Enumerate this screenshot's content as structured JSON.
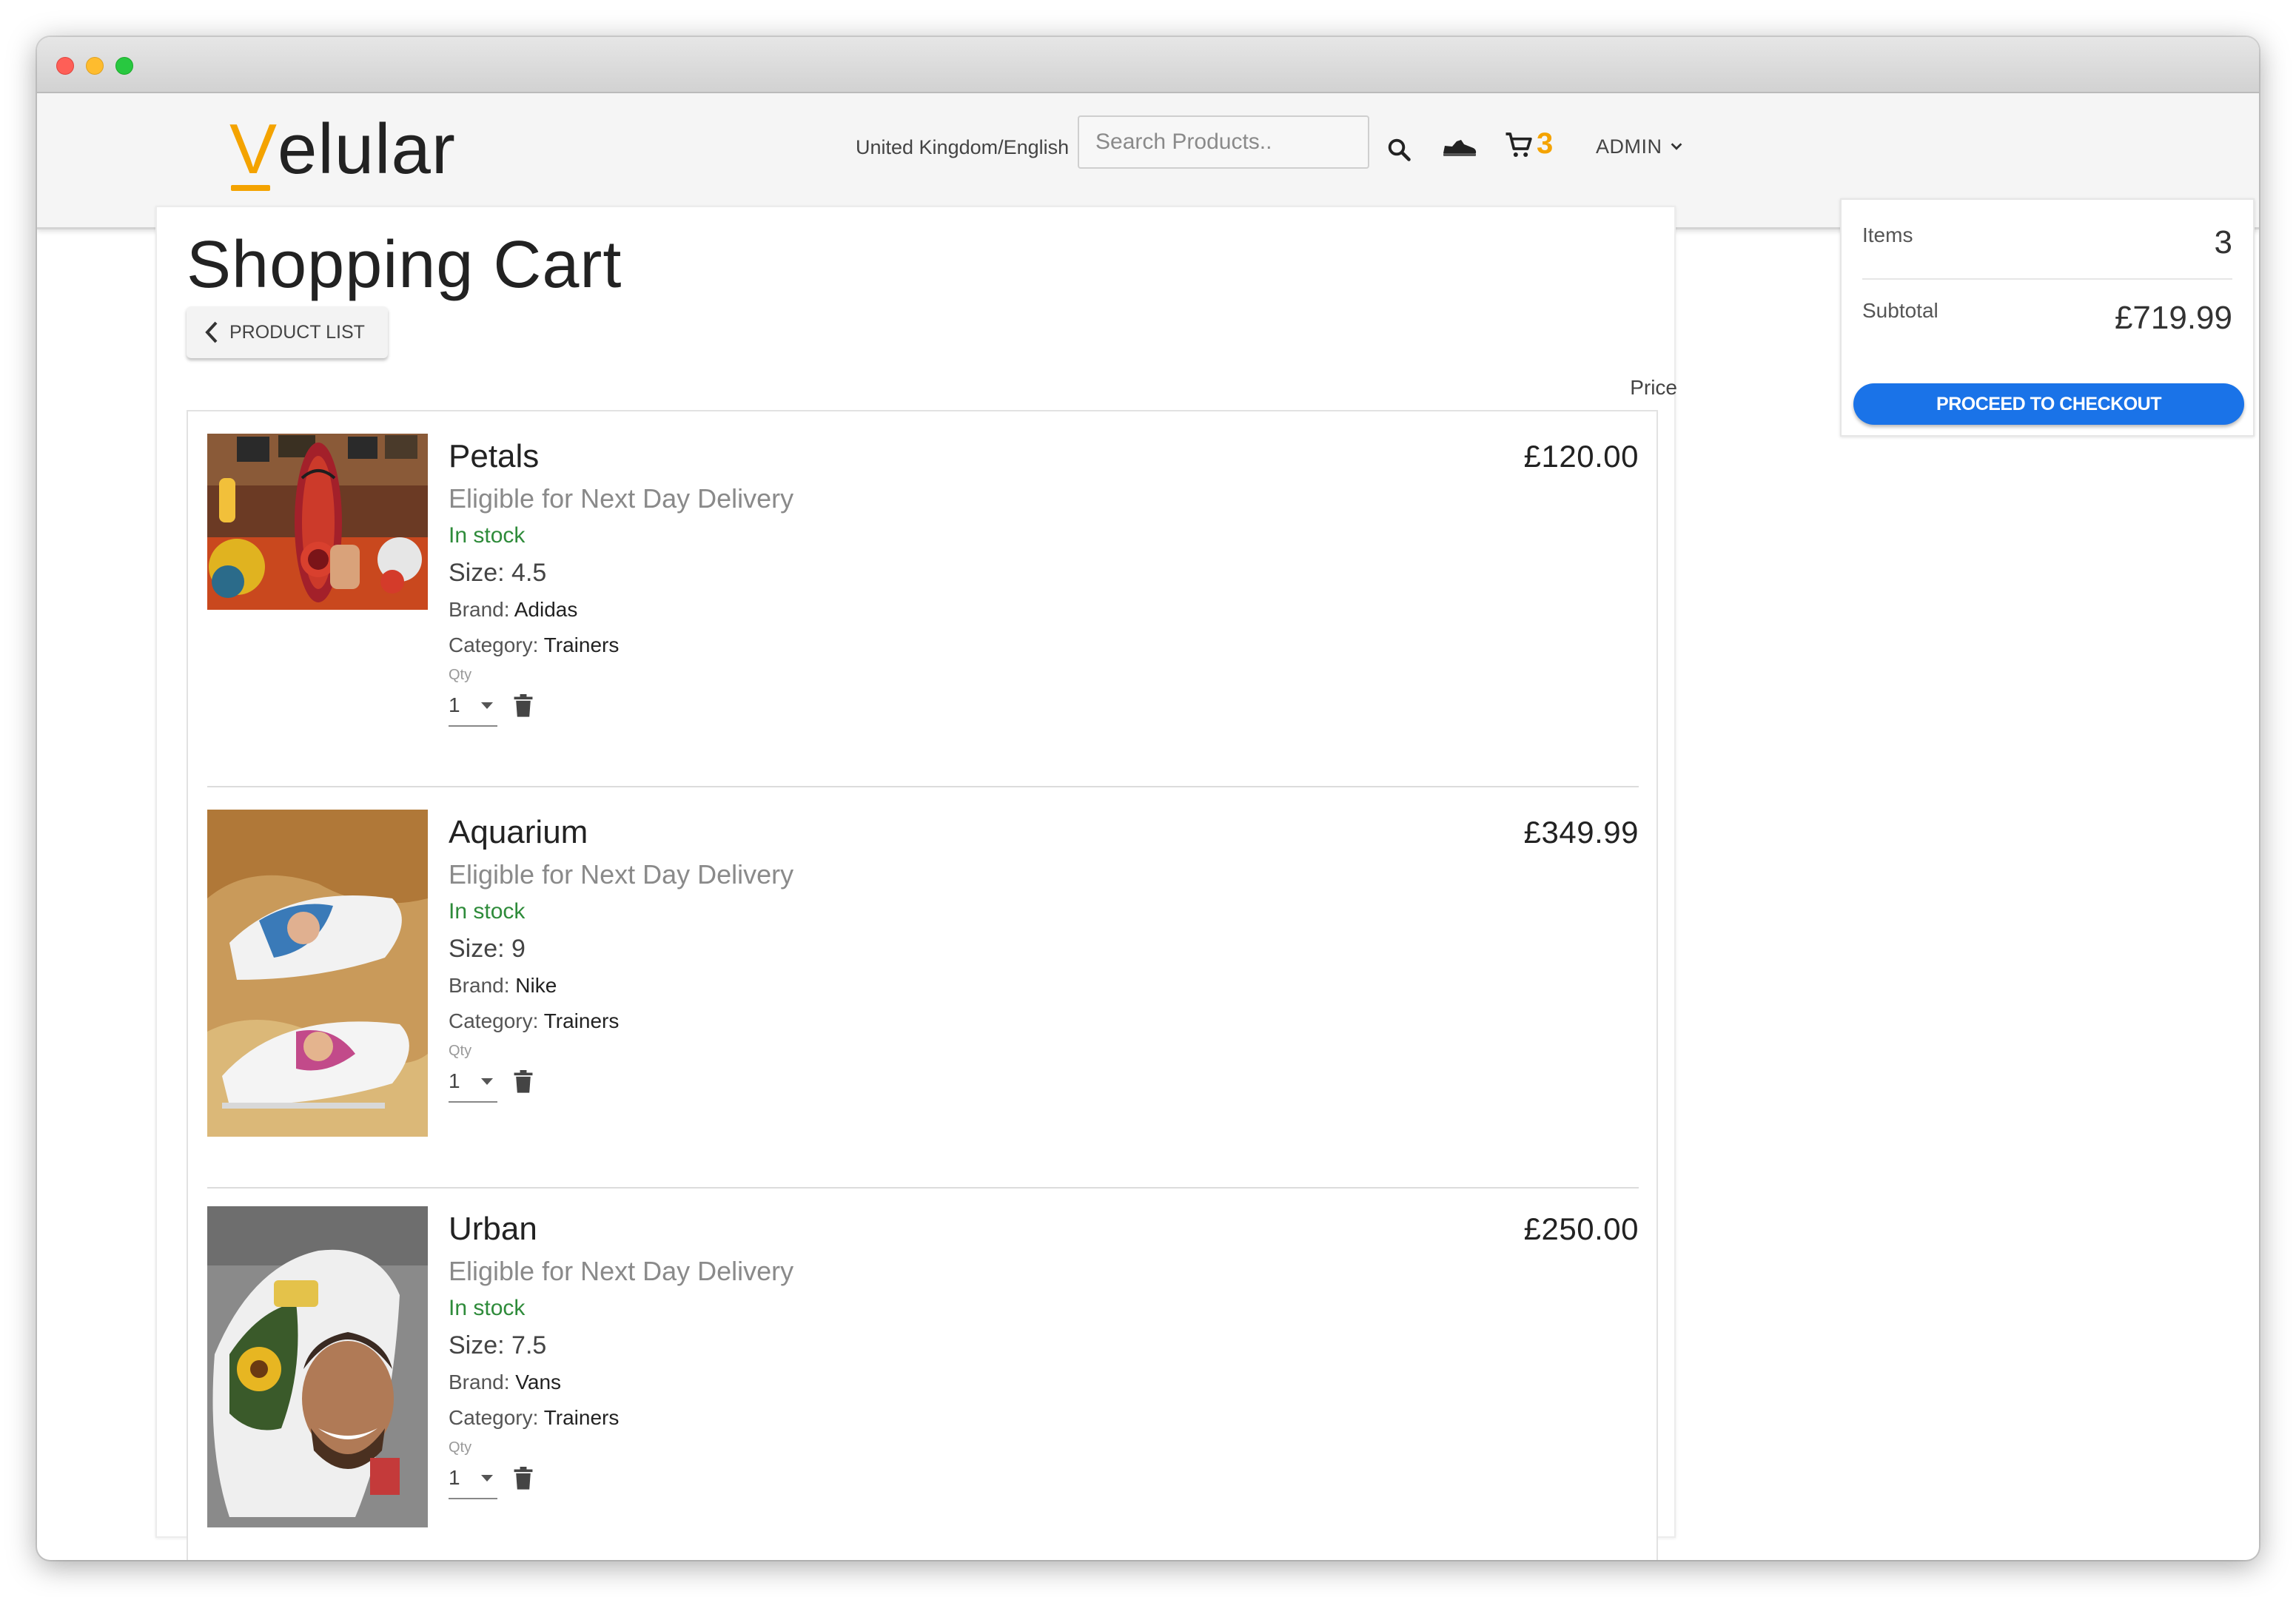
{
  "brand": {
    "logo_first": "V",
    "logo_rest": "elular",
    "accent_color": "#f4a300"
  },
  "header": {
    "locale": "United Kingdom/English",
    "search_placeholder": "Search Products..",
    "cart_count": "3",
    "admin_label": "ADMIN",
    "icons": [
      "search-icon",
      "shoe-icon",
      "cart-icon",
      "chevron-down-icon"
    ]
  },
  "page": {
    "title": "Shopping Cart",
    "back_label": "PRODUCT LIST",
    "price_header": "Price"
  },
  "cart": {
    "items": [
      {
        "name": "Petals",
        "delivery": "Eligible for Next Day Delivery",
        "stock": "In stock",
        "size": "Size: 4.5",
        "brand_label": "Brand:",
        "brand": "Adidas",
        "category_label": "Category:",
        "category": "Trainers",
        "qty_label": "Qty",
        "qty": "1",
        "price": "£120.00"
      },
      {
        "name": "Aquarium",
        "delivery": "Eligible for Next Day Delivery",
        "stock": "In stock",
        "size": "Size: 9",
        "brand_label": "Brand:",
        "brand": "Nike",
        "category_label": "Category:",
        "category": "Trainers",
        "qty_label": "Qty",
        "qty": "1",
        "price": "£349.99"
      },
      {
        "name": "Urban",
        "delivery": "Eligible for Next Day Delivery",
        "stock": "In stock",
        "size": "Size: 7.5",
        "brand_label": "Brand:",
        "brand": "Vans",
        "category_label": "Category:",
        "category": "Trainers",
        "qty_label": "Qty",
        "qty": "1",
        "price": "£250.00"
      }
    ]
  },
  "summary": {
    "items_label": "Items",
    "items_value": "3",
    "subtotal_label": "Subtotal",
    "subtotal_value": "£719.99",
    "checkout_label": "PROCEED TO CHECKOUT",
    "checkout_color": "#1a73e8"
  }
}
